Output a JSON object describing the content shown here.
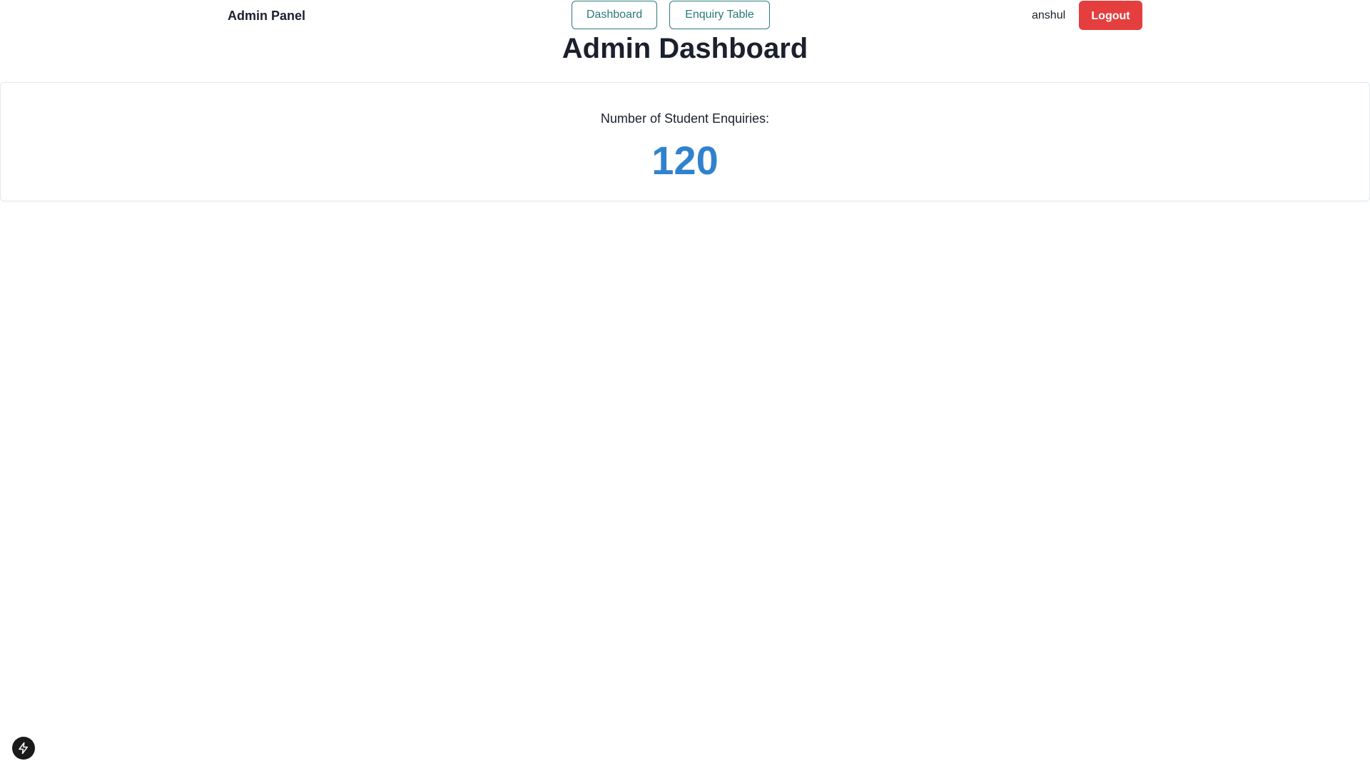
{
  "nav": {
    "brand": "Admin Panel",
    "links": [
      {
        "label": "Dashboard"
      },
      {
        "label": "Enquiry Table"
      }
    ],
    "username": "anshul",
    "logout_label": "Logout"
  },
  "page": {
    "title": "Admin Dashboard"
  },
  "stat_card": {
    "label": "Number of Student Enquiries:",
    "value": "120"
  },
  "colors": {
    "accent_teal": "#2c7a7b",
    "logout_red": "#e53e3e",
    "stat_blue": "#3182ce",
    "text_dark": "#1a202c"
  },
  "icons": {
    "floating_badge": "lightning-bolt-icon"
  }
}
